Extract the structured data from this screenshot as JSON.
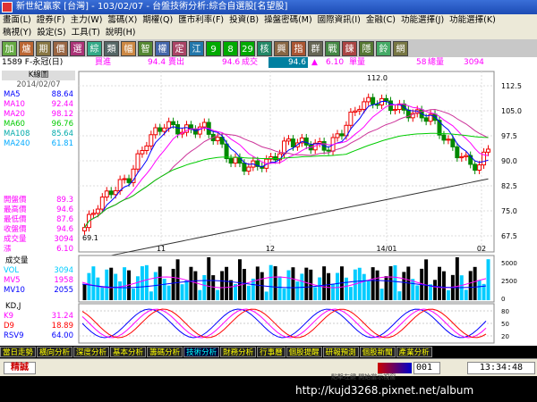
{
  "window": {
    "title": "新世紀贏家 [台灣] - 103/02/07 - 台盤技術分析:綜合自選股[名望股]"
  },
  "menu": {
    "row1": [
      "畫面(L)",
      "證券(F)",
      "主力(W)",
      "籌碼(X)",
      "期權(Q)",
      "匯市利率(F)",
      "投資(B)",
      "操盤密碼(M)",
      "國際資訊(I)",
      "金融(C)",
      "功能選擇(J)",
      "功能選擇(K)"
    ],
    "row2": [
      "稿視(Y)",
      "設定(S)",
      "工具(T)",
      "說明(H)"
    ]
  },
  "toolbar": [
    "加",
    "爐",
    "期",
    "價",
    "選",
    "綜",
    "類",
    "幅",
    "智",
    "權",
    "定",
    "江",
    "9",
    "8",
    "29",
    "核",
    "興",
    "指",
    "群",
    "戰",
    "鍊",
    "隱",
    "鈴",
    "網"
  ],
  "info": {
    "stock": "1589 F-永冠(日)",
    "buy_label": "買進",
    "buy": "94.4",
    "sell_label": "賣出",
    "sell": "94.6",
    "deal_label": "成交",
    "deal": "94.6",
    "change_label": "▲",
    "change": "6.10",
    "vol_label": "單量",
    "vol": "58",
    "total_label": "總量",
    "total": "3094"
  },
  "chart_header": {
    "title": "K線圖",
    "date": "2014/02/07"
  },
  "ma_legend": [
    {
      "name": "MA5",
      "value": "88.64",
      "color": "#0000ff"
    },
    {
      "name": "MA10",
      "value": "92.44",
      "color": "#ff00ff"
    },
    {
      "name": "MA20",
      "value": "98.12",
      "color": "#ff00ff"
    },
    {
      "name": "MA60",
      "value": "96.76",
      "color": "#00cc00"
    },
    {
      "name": "MA108",
      "value": "85.64",
      "color": "#00aaaa"
    },
    {
      "name": "MA240",
      "value": "61.81",
      "color": "#00aaff"
    }
  ],
  "quote_legend": [
    {
      "name": "開盤價",
      "value": "89.3"
    },
    {
      "name": "最高價",
      "value": "94.6"
    },
    {
      "name": "最低價",
      "value": "87.6"
    },
    {
      "name": "收盤價",
      "value": "94.6"
    },
    {
      "name": "成交量",
      "value": "3094"
    },
    {
      "name": "漲",
      "value": "6.10"
    }
  ],
  "vol_header": "成交量",
  "vol_legend": [
    {
      "name": "VOL",
      "value": "3094",
      "color": "#00ccff"
    },
    {
      "name": "MV5",
      "value": "1958",
      "color": "#ff00ff"
    },
    {
      "name": "MV10",
      "value": "2055",
      "color": "#0000ff"
    }
  ],
  "kd_header": "KD,J",
  "kd_legend": [
    {
      "name": "K9",
      "value": "31.24",
      "color": "#ff00ff"
    },
    {
      "name": "D9",
      "value": "18.89",
      "color": "#ff0000"
    },
    {
      "name": "RSV9",
      "value": "64.00",
      "color": "#0000ff"
    }
  ],
  "chart_data": {
    "type": "candlestick",
    "y_ticks": [
      "112.5",
      "105.0",
      "97.5",
      "90.0",
      "82.5",
      "75.0",
      "67.5"
    ],
    "x_ticks": [
      "11",
      "12",
      "14/01",
      "02"
    ],
    "annotations": [
      "112.0",
      "69.1"
    ],
    "vol_ticks": [
      "5000",
      "2500",
      "0"
    ],
    "kd_ticks": [
      "80",
      "50",
      "20"
    ]
  },
  "tabs": [
    "當日走勢",
    "橫向分析",
    "深度分析",
    "基本分析",
    "籌碼分析",
    "技術分析",
    "財務分析",
    "行事曆",
    "個股提醒",
    "研報預測",
    "個股新聞",
    "產業分析"
  ],
  "status": {
    "label": "精誠",
    "code": "001",
    "time": "13:34:48",
    "hint": "點擊左鍵 開始當示視窗"
  },
  "watermark": "http://kujd3268.pixnet.net/album"
}
